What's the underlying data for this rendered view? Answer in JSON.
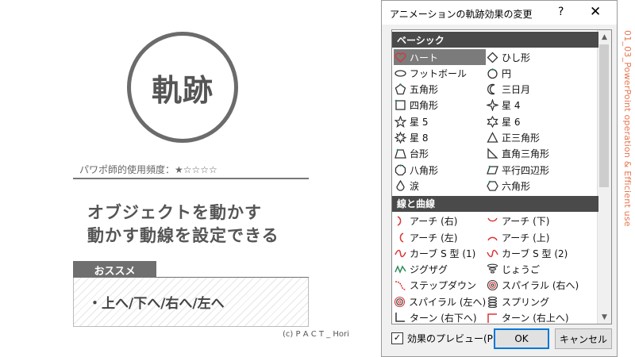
{
  "slide": {
    "circle_title": "軌跡",
    "frequency": "パワポ師的使用頻度：★☆☆☆☆",
    "main_line1": "オブジェクトを動かす",
    "main_line2": "動かす動線を設定できる",
    "tag": "おススメ",
    "recommend": "・上へ/下へ/右へ/左へ",
    "credit": "(c) P A C T _ Hori",
    "vertical_text": "01_03_PowerPoint operation & Efficient use"
  },
  "dialog": {
    "title": "アニメーションの軌跡効果の変更",
    "help": "?",
    "close": "✕",
    "sections": [
      {
        "name": "ベーシック",
        "items": [
          {
            "label": "ハート",
            "icon": "heart-icon"
          },
          {
            "label": "ひし形",
            "icon": "diamond-icon"
          },
          {
            "label": "フットボール",
            "icon": "football-icon"
          },
          {
            "label": "円",
            "icon": "circle-icon"
          },
          {
            "label": "五角形",
            "icon": "pentagon-icon"
          },
          {
            "label": "三日月",
            "icon": "crescent-icon"
          },
          {
            "label": "四角形",
            "icon": "square-icon"
          },
          {
            "label": "星 4",
            "icon": "star4-icon"
          },
          {
            "label": "星 5",
            "icon": "star5-icon"
          },
          {
            "label": "星 6",
            "icon": "star6-icon"
          },
          {
            "label": "星 8",
            "icon": "star8-icon"
          },
          {
            "label": "正三角形",
            "icon": "triangle-icon"
          },
          {
            "label": "台形",
            "icon": "trapezoid-icon"
          },
          {
            "label": "直角三角形",
            "icon": "right-triangle-icon"
          },
          {
            "label": "八角形",
            "icon": "octagon-icon"
          },
          {
            "label": "平行四辺形",
            "icon": "parallelogram-icon"
          },
          {
            "label": "涙",
            "icon": "teardrop-icon"
          },
          {
            "label": "六角形",
            "icon": "hexagon-icon"
          }
        ]
      },
      {
        "name": "線と曲線",
        "items": [
          {
            "label": "アーチ (右)",
            "icon": "arc-right-icon"
          },
          {
            "label": "アーチ (下)",
            "icon": "arc-down-icon"
          },
          {
            "label": "アーチ (左)",
            "icon": "arc-left-icon"
          },
          {
            "label": "アーチ (上)",
            "icon": "arc-up-icon"
          },
          {
            "label": "カーブ S 型 (1)",
            "icon": "s-curve-1-icon"
          },
          {
            "label": "カーブ S 型 (2)",
            "icon": "s-curve-2-icon"
          },
          {
            "label": "ジグザグ",
            "icon": "zigzag-icon"
          },
          {
            "label": "じょうご",
            "icon": "funnel-icon"
          },
          {
            "label": "ステップダウン",
            "icon": "step-down-icon"
          },
          {
            "label": "スパイラル (右へ)",
            "icon": "spiral-right-icon"
          },
          {
            "label": "スパイラル (左へ)",
            "icon": "spiral-left-icon"
          },
          {
            "label": "スプリング",
            "icon": "spring-icon"
          },
          {
            "label": "ターン (右下へ)",
            "icon": "turn-down-right-icon"
          },
          {
            "label": "ターン (右上へ)",
            "icon": "turn-up-right-icon"
          }
        ]
      }
    ],
    "selected_item": "ハート",
    "preview_label": "効果のプレビュー(P)",
    "preview_checked": true,
    "ok": "OK",
    "cancel": "キャンセル"
  }
}
